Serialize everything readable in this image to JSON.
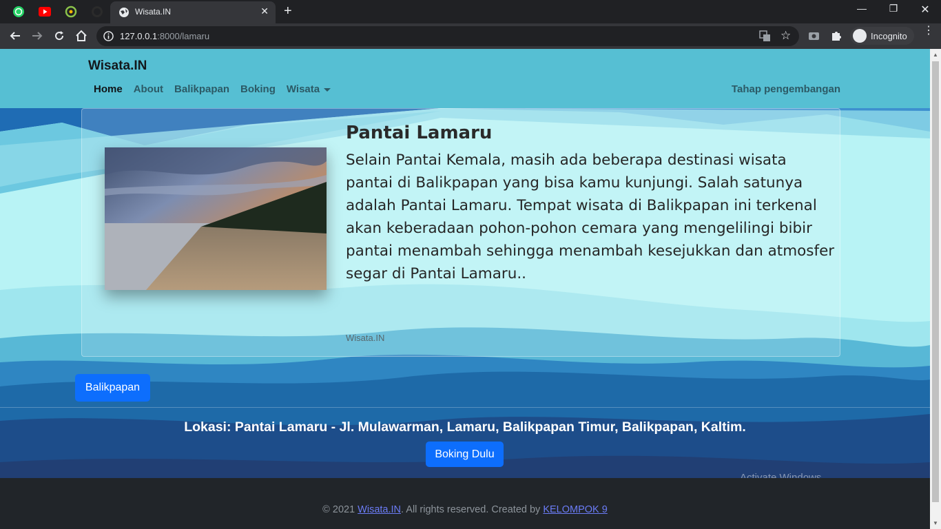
{
  "browser": {
    "tab_title": "Wisata.IN",
    "url_host": "127.0.0.1",
    "url_path": ":8000/lamaru",
    "incognito_label": "Incognito",
    "icons": [
      "whatsapp-icon",
      "youtube-icon",
      "app-icon",
      "github-icon",
      "globe-icon",
      "back-icon",
      "forward-icon",
      "reload-icon",
      "home-icon",
      "info-icon",
      "translate-icon",
      "star-icon",
      "camera-icon",
      "extensions-icon",
      "incognito-icon",
      "menu-icon"
    ]
  },
  "navbar": {
    "brand": "Wisata.IN",
    "links": [
      "Home",
      "About",
      "Balikpapan",
      "Boking",
      "Wisata"
    ],
    "right_text": "Tahap pengembangan"
  },
  "card": {
    "title": "Pantai Lamaru",
    "text": "Selain Pantai Kemala, masih ada beberapa destinasi wisata pantai di Balikpapan yang bisa kamu kunjungi. Salah satunya adalah Pantai Lamaru. Tempat wisata di Balikpapan ini terkenal akan keberadaan pohon-pohon cemara yang mengelilingi bibir pantai menambah sehingga menambah kesejukkan dan atmosfer segar di Pantai Lamaru..",
    "footer": "Wisata.IN"
  },
  "buttons": {
    "balikpapan": "Balikpapan",
    "boking": "Boking Dulu"
  },
  "lokasi": "Lokasi: Pantai Lamaru - Jl. Mulawarman, Lamaru, Balikpapan Timur, Balikpapan, Kaltim.",
  "watermark": "Activate Windows",
  "footer": {
    "prefix": "© 2021 ",
    "site_link": "Wisata.IN",
    "middle": ". All rights reserved. Created by ",
    "author_link": "KELOMPOK 9"
  },
  "colors": {
    "accent": "#0d6efd",
    "navbar": "#56bfd3",
    "footer": "#212529"
  }
}
